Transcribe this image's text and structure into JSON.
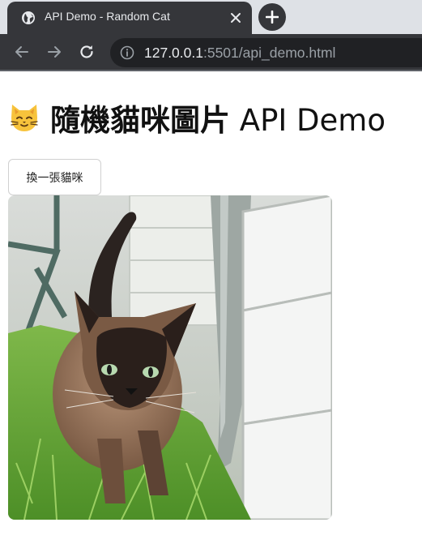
{
  "browser": {
    "tab_title": "API Demo - Random Cat",
    "url_host": "127.0.0.1",
    "url_rest": ":5501/api_demo.html"
  },
  "page": {
    "heading_cjk": "隨機貓咪圖片",
    "heading_latin": " API Demo",
    "next_button_label": "換一張貓咪"
  },
  "icons": {
    "favicon": "globe-icon",
    "close": "close-icon",
    "new_tab": "plus-icon",
    "back": "arrow-left-icon",
    "forward": "arrow-right-icon",
    "reload": "reload-icon",
    "site_info": "info-icon",
    "heading_emoji": "cat-face-emoji"
  }
}
